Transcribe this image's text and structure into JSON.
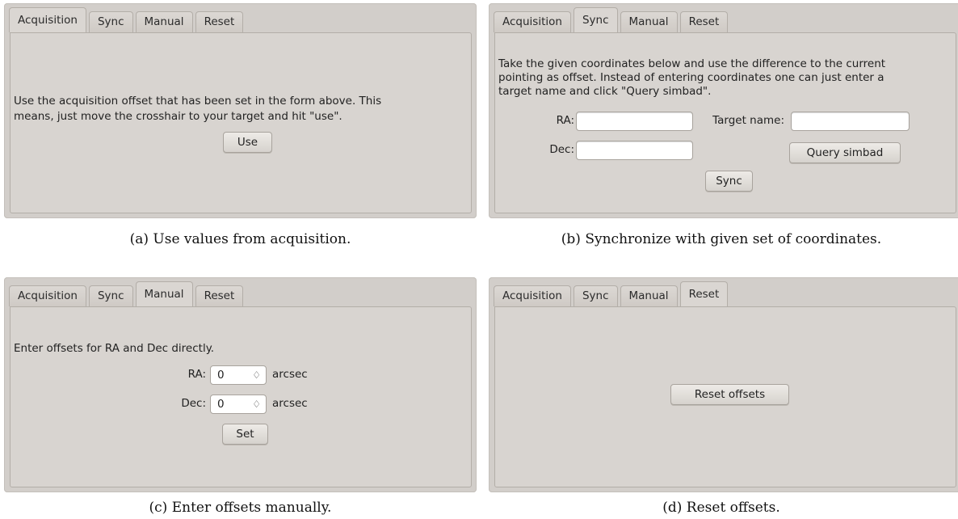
{
  "tabs": [
    "Acquisition",
    "Sync",
    "Manual",
    "Reset"
  ],
  "panel_a": {
    "description_line1": "Use the acquisition offset that has been set in the form above. This",
    "description_line2": "means, just move the crosshair to your target and hit \"use\".",
    "use_button": "Use",
    "caption": "(a) Use values from acquisition."
  },
  "panel_b": {
    "description_line1": "Take the given coordinates below and use the difference to the current",
    "description_line2": "pointing as offset. Instead of entering coordinates one can just enter a",
    "description_line3": "target name and click \"Query simbad\".",
    "ra_label": "RA:",
    "dec_label": "Dec:",
    "target_label": "Target name:",
    "ra_value": "",
    "dec_value": "",
    "target_value": "",
    "query_button": "Query simbad",
    "sync_button": "Sync",
    "caption": "(b) Synchronize with given set of coordinates."
  },
  "panel_c": {
    "description": "Enter offsets for RA and Dec directly.",
    "ra_label": "RA:",
    "dec_label": "Dec:",
    "ra_value": "0",
    "dec_value": "0",
    "unit": "arcsec",
    "set_button": "Set",
    "caption": "(c) Enter offsets manually."
  },
  "panel_d": {
    "reset_button": "Reset offsets",
    "caption": "(d) Reset offsets."
  },
  "icons": {
    "spin_arrows": "♢"
  }
}
